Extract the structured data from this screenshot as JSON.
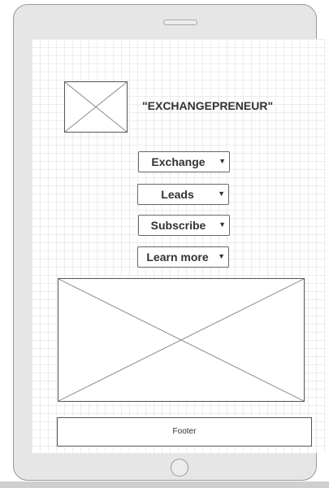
{
  "app": {
    "title": "\"EXCHANGEPRENEUR\""
  },
  "menu": {
    "exchange": "Exchange",
    "leads": "Leads",
    "subscribe": "Subscribe",
    "learn_more": "Learn more",
    "caret_glyph": "▼"
  },
  "footer": {
    "label": "Footer"
  }
}
